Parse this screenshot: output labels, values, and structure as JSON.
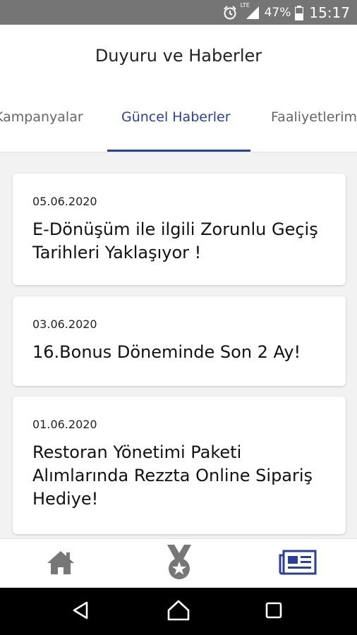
{
  "status_bar": {
    "network_label": "LTE",
    "battery_percent": "47%",
    "time": "15:17",
    "icons": [
      "alarm-icon",
      "signal-icon",
      "battery-icon"
    ]
  },
  "header": {
    "title": "Duyuru ve Haberler"
  },
  "tabs": [
    {
      "label": "Kampanyalar",
      "active": false
    },
    {
      "label": "Güncel Haberler",
      "active": true
    },
    {
      "label": "Faaliyetlerimiz",
      "active": false
    }
  ],
  "news": [
    {
      "date": "05.06.2020",
      "title": "E-Dönüşüm ile ilgili Zorunlu Geçiş Tarihleri Yaklaşıyor !"
    },
    {
      "date": "03.06.2020",
      "title": "16.Bonus Döneminde Son 2 Ay!"
    },
    {
      "date": "01.06.2020",
      "title": "Restoran Yönetimi Paketi Alımlarında Rezzta Online Sipariş Hediye!"
    }
  ],
  "bottom_nav": [
    {
      "icon": "home-icon",
      "active": false
    },
    {
      "icon": "medal-icon",
      "active": false
    },
    {
      "icon": "newspaper-icon",
      "active": true
    }
  ],
  "system_nav": {
    "icons": [
      "back-icon",
      "home-circle-icon",
      "recents-icon"
    ]
  },
  "colors": {
    "accent": "#2b3f97",
    "status_bar": "#757575",
    "background": "#f2f2f2",
    "inactive_icon": "#777777"
  }
}
